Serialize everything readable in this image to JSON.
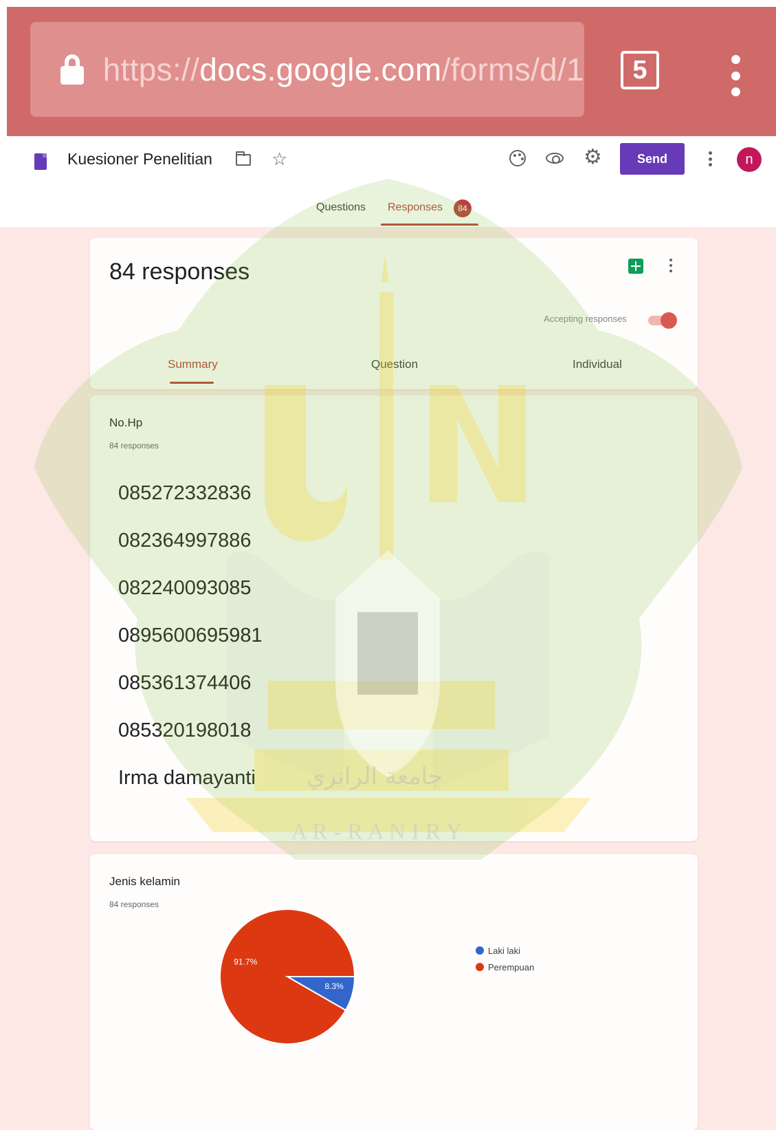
{
  "browser": {
    "url_scheme": "https://",
    "url_host": "docs.google.com",
    "url_path": "/forms/d/1",
    "tab_count": "5"
  },
  "form": {
    "title": "Kuesioner Penelitian",
    "send_label": "Send",
    "avatar_initial": "n",
    "tabs": {
      "questions": "Questions",
      "responses": "Responses",
      "responses_badge": "84"
    }
  },
  "responses_card": {
    "heading": "84 responses",
    "accepting_label": "Accepting responses",
    "accepting_on": true,
    "subtabs": {
      "summary": "Summary",
      "question": "Question",
      "individual": "Individual"
    }
  },
  "nohp_card": {
    "title": "No.Hp",
    "count": "84 responses",
    "answers": [
      "085272332836",
      "082364997886",
      "082240093085",
      "0895600695981",
      "085361374406",
      "085320198018",
      "Irma damayanti"
    ]
  },
  "gender_card": {
    "title": "Jenis kelamin",
    "count": "84 responses"
  },
  "chart_data": {
    "type": "pie",
    "categories": [
      "Laki laki",
      "Perempuan"
    ],
    "values": [
      8.3,
      91.7
    ],
    "labels": [
      "8.3%",
      "91.7%"
    ],
    "colors": [
      "#3366cc",
      "#dc3912"
    ],
    "legend_position": "right"
  },
  "watermark": {
    "logo_letters": "UIN",
    "arabic_text": "جامعة الرانري",
    "latin_text": "A R - R A N I R Y"
  },
  "colors": {
    "browser_bar": "#cf6a69",
    "accent": "#673ab7",
    "responses_accent": "#b7443c"
  }
}
